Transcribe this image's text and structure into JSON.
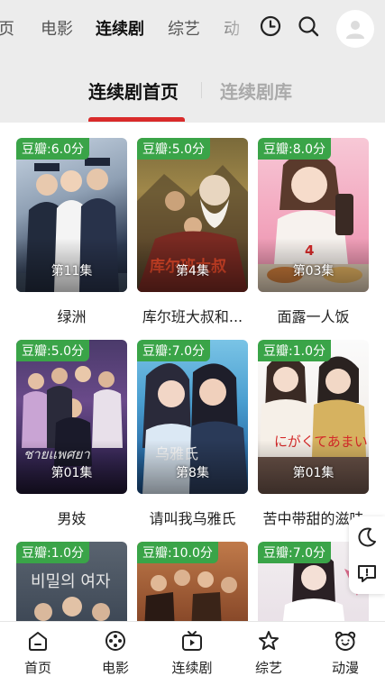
{
  "top_nav": {
    "tabs": [
      {
        "label": "页",
        "active": false
      },
      {
        "label": "电影",
        "active": false
      },
      {
        "label": "连续剧",
        "active": true
      },
      {
        "label": "综艺",
        "active": false
      },
      {
        "label": "动",
        "active": false
      }
    ],
    "icons": [
      "history-icon",
      "search-icon",
      "user-avatar-icon"
    ],
    "highlight_color": "#f6cf5a"
  },
  "sub_tabs": {
    "items": [
      {
        "label": "连续剧首页",
        "active": true
      },
      {
        "label": "连续剧库",
        "active": false
      }
    ],
    "indicator_color": "#d92b2b"
  },
  "cards": [
    {
      "score": "豆瓣:6.0分",
      "episode": "第11集",
      "title": "绿洲"
    },
    {
      "score": "豆瓣:5.0分",
      "episode": "第4集",
      "title": "库尔班大叔和..."
    },
    {
      "score": "豆瓣:8.0分",
      "episode": "第03集",
      "title": "面露一人饭"
    },
    {
      "score": "豆瓣:5.0分",
      "episode": "第01集",
      "title": "男妓"
    },
    {
      "score": "豆瓣:7.0分",
      "episode": "第8集",
      "title": "请叫我乌雅氏"
    },
    {
      "score": "豆瓣:1.0分",
      "episode": "第01集",
      "title": "苦中带甜的滋味"
    },
    {
      "score": "豆瓣:1.0分",
      "episode": "",
      "title": ""
    },
    {
      "score": "豆瓣:10.0分",
      "episode": "",
      "title": ""
    },
    {
      "score": "豆瓣:7.0分",
      "episode": "",
      "title": ""
    }
  ],
  "score_badge_color": "#3aa448",
  "float_buttons": [
    "moon-icon",
    "feedback-icon"
  ],
  "bottom_nav": {
    "items": [
      {
        "label": "首页",
        "icon": "home-icon"
      },
      {
        "label": "电影",
        "icon": "film-reel-icon"
      },
      {
        "label": "连续剧",
        "icon": "tv-icon"
      },
      {
        "label": "综艺",
        "icon": "star-icon"
      },
      {
        "label": "动漫",
        "icon": "bear-face-icon"
      }
    ]
  }
}
